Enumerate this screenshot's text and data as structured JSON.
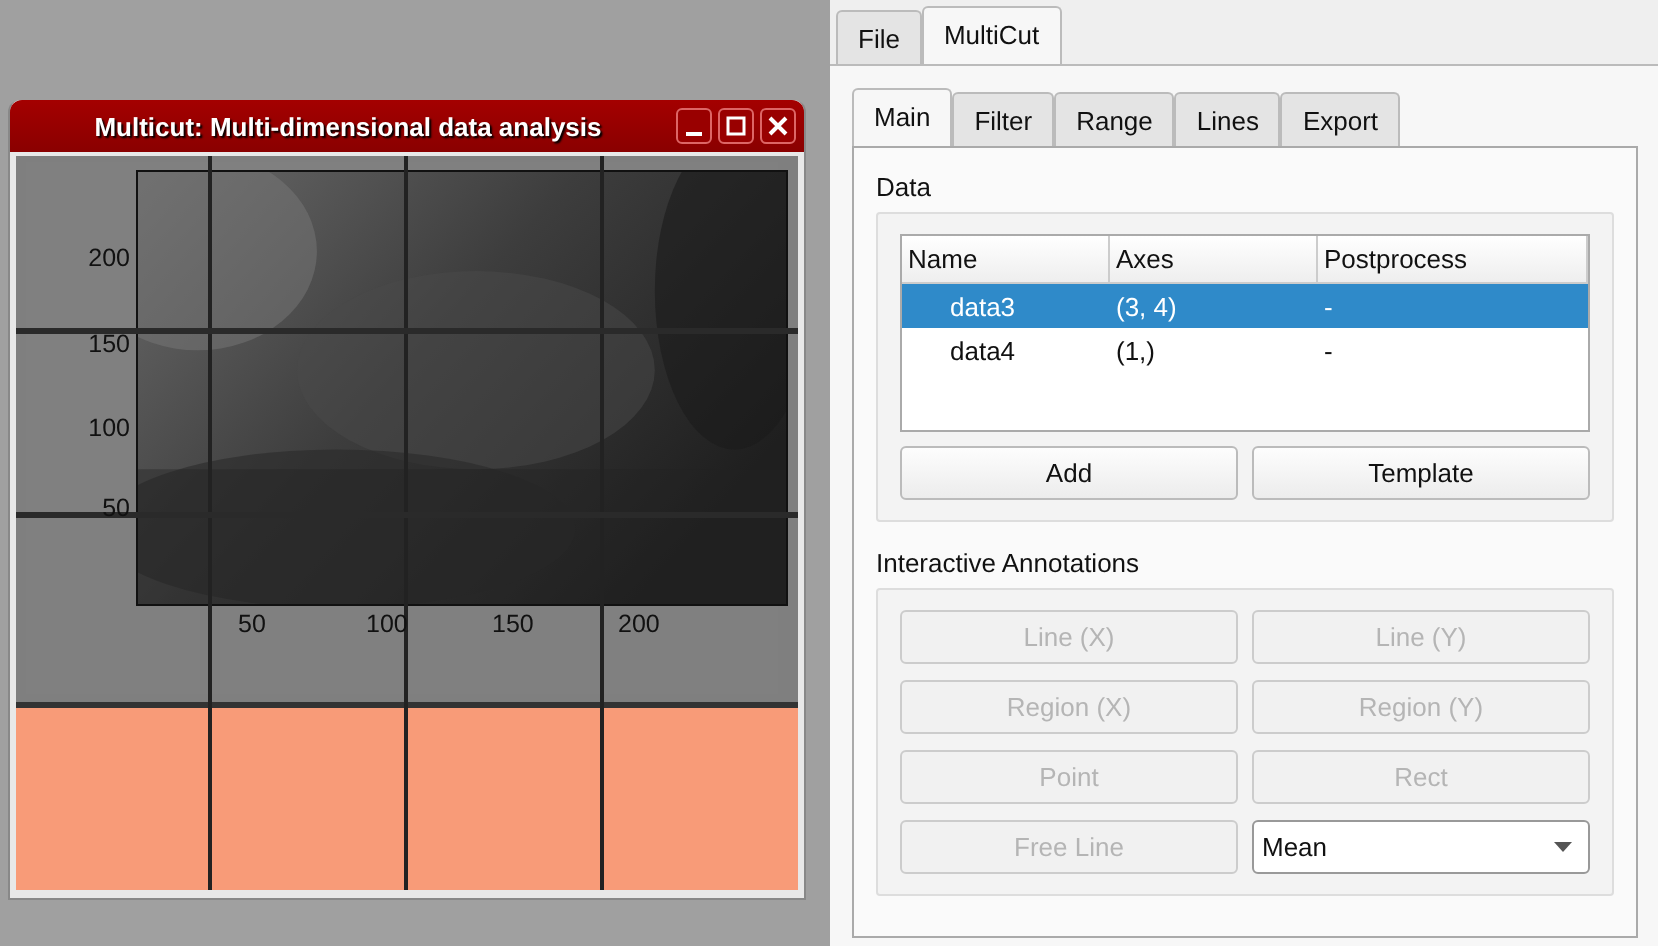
{
  "window": {
    "title": "Multicut: Multi-dimensional data analysis"
  },
  "plot": {
    "yticks": [
      "200",
      "150",
      "100",
      "50"
    ],
    "xticks": [
      "50",
      "100",
      "150",
      "200"
    ]
  },
  "top_tabs": [
    {
      "label": "File",
      "selected": false
    },
    {
      "label": "MultiCut",
      "selected": true
    }
  ],
  "sub_tabs": [
    {
      "label": "Main",
      "selected": true
    },
    {
      "label": "Filter",
      "selected": false
    },
    {
      "label": "Range",
      "selected": false
    },
    {
      "label": "Lines",
      "selected": false
    },
    {
      "label": "Export",
      "selected": false
    }
  ],
  "data_section": {
    "title": "Data",
    "columns": [
      "Name",
      "Axes",
      "Postprocess"
    ],
    "rows": [
      {
        "cells": [
          "data3",
          "(3, 4)",
          "-"
        ],
        "selected": true
      },
      {
        "cells": [
          "data4",
          "(1,)",
          "-"
        ],
        "selected": false
      }
    ],
    "buttons": [
      "Add",
      "Template"
    ]
  },
  "annotations": {
    "title": "Interactive Annotations",
    "buttons": [
      {
        "label": "Line (X)",
        "disabled": true
      },
      {
        "label": "Line (Y)",
        "disabled": true
      },
      {
        "label": "Region (X)",
        "disabled": true
      },
      {
        "label": "Region (Y)",
        "disabled": true
      },
      {
        "label": "Point",
        "disabled": true
      },
      {
        "label": "Rect",
        "disabled": true
      },
      {
        "label": "Free Line",
        "disabled": true
      }
    ],
    "dropdown": {
      "value": "Mean"
    }
  }
}
